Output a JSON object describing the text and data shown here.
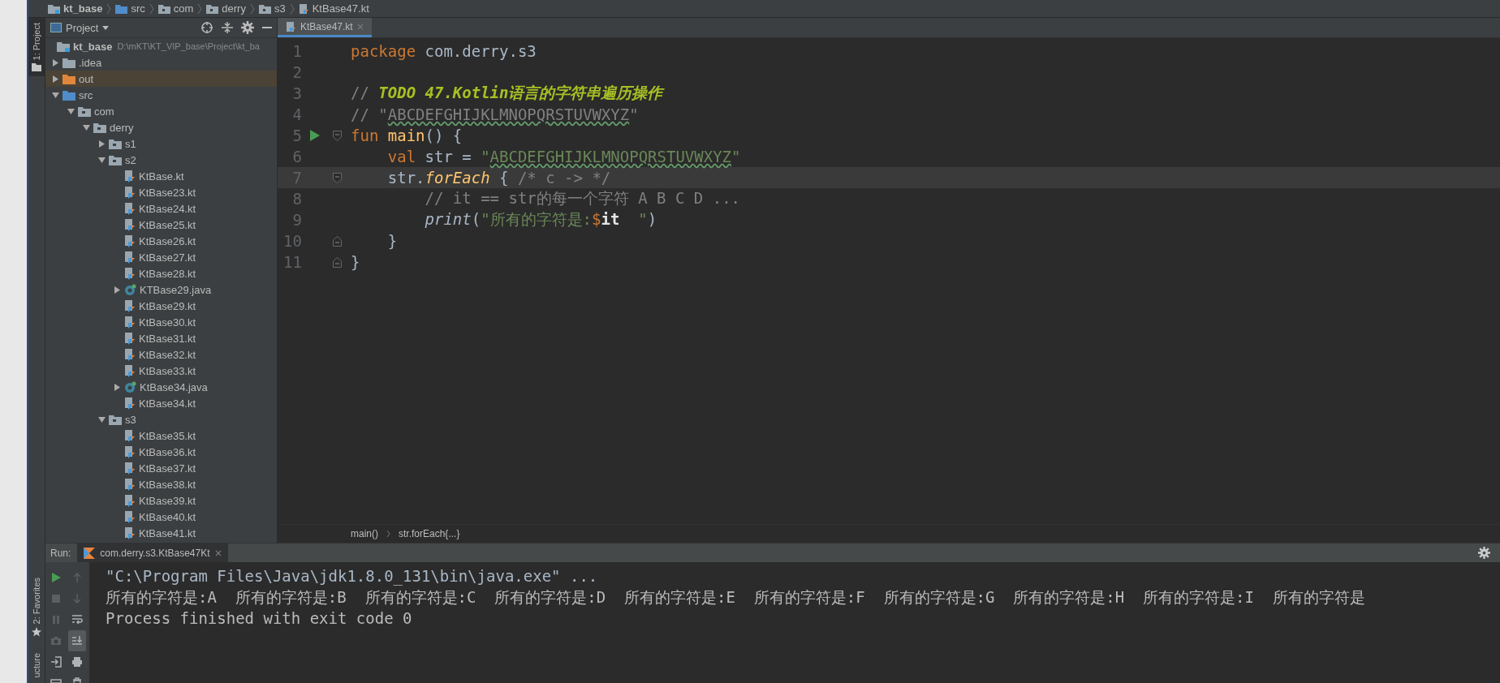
{
  "breadcrumbs": [
    {
      "label": "kt_base",
      "kind": "module"
    },
    {
      "label": "src",
      "kind": "source-folder"
    },
    {
      "label": "com",
      "kind": "package"
    },
    {
      "label": "derry",
      "kind": "package"
    },
    {
      "label": "s3",
      "kind": "package"
    },
    {
      "label": "KtBase47.kt",
      "kind": "kotlin-file"
    }
  ],
  "tool_strip": {
    "top": [
      {
        "label": "1: Project",
        "selected": true
      }
    ],
    "bottom": [
      {
        "label": "2: Favorites",
        "selected": false
      },
      {
        "label": "ucture",
        "selected": false
      }
    ]
  },
  "project": {
    "title": "Project",
    "tree": [
      {
        "label": "kt_base",
        "path": "D:\\mKT\\KT_VIP_base\\Project\\kt_ba",
        "kind": "module",
        "selected": false,
        "children": [
          {
            "label": ".idea",
            "kind": "folder",
            "expanded": false,
            "selected": false
          },
          {
            "label": "out",
            "kind": "excluded-folder",
            "expanded": false,
            "selected": true
          },
          {
            "label": "src",
            "kind": "source-folder",
            "expanded": true,
            "selected": false,
            "children": [
              {
                "label": "com",
                "kind": "package",
                "expanded": true,
                "selected": false,
                "children": [
                  {
                    "label": "derry",
                    "kind": "package",
                    "expanded": true,
                    "selected": false,
                    "children": [
                      {
                        "label": "s1",
                        "kind": "package",
                        "expanded": false,
                        "selected": false
                      },
                      {
                        "label": "s2",
                        "kind": "package",
                        "expanded": true,
                        "selected": false,
                        "children": [
                          {
                            "label": "KtBase.kt",
                            "kind": "kotlin-file",
                            "selected": false
                          },
                          {
                            "label": "KtBase23.kt",
                            "kind": "kotlin-file",
                            "selected": false
                          },
                          {
                            "label": "KtBase24.kt",
                            "kind": "kotlin-file",
                            "selected": false
                          },
                          {
                            "label": "KtBase25.kt",
                            "kind": "kotlin-file",
                            "selected": false
                          },
                          {
                            "label": "KtBase26.kt",
                            "kind": "kotlin-file",
                            "selected": false
                          },
                          {
                            "label": "KtBase27.kt",
                            "kind": "kotlin-file",
                            "selected": false
                          },
                          {
                            "label": "KtBase28.kt",
                            "kind": "kotlin-file",
                            "selected": false
                          },
                          {
                            "label": "KTBase29.java",
                            "kind": "java-class",
                            "expanded": false,
                            "selected": false
                          },
                          {
                            "label": "KtBase29.kt",
                            "kind": "kotlin-file",
                            "selected": false
                          },
                          {
                            "label": "KtBase30.kt",
                            "kind": "kotlin-file",
                            "selected": false
                          },
                          {
                            "label": "KtBase31.kt",
                            "kind": "kotlin-file",
                            "selected": false
                          },
                          {
                            "label": "KtBase32.kt",
                            "kind": "kotlin-file",
                            "selected": false
                          },
                          {
                            "label": "KtBase33.kt",
                            "kind": "kotlin-file",
                            "selected": false
                          },
                          {
                            "label": "KtBase34.java",
                            "kind": "java-class",
                            "expanded": false,
                            "selected": false
                          },
                          {
                            "label": "KtBase34.kt",
                            "kind": "kotlin-file",
                            "selected": false
                          }
                        ]
                      },
                      {
                        "label": "s3",
                        "kind": "package",
                        "expanded": true,
                        "selected": false,
                        "children": [
                          {
                            "label": "KtBase35.kt",
                            "kind": "kotlin-file",
                            "selected": false
                          },
                          {
                            "label": "KtBase36.kt",
                            "kind": "kotlin-file",
                            "selected": false
                          },
                          {
                            "label": "KtBase37.kt",
                            "kind": "kotlin-file",
                            "selected": false
                          },
                          {
                            "label": "KtBase38.kt",
                            "kind": "kotlin-file",
                            "selected": false
                          },
                          {
                            "label": "KtBase39.kt",
                            "kind": "kotlin-file",
                            "selected": false
                          },
                          {
                            "label": "KtBase40.kt",
                            "kind": "kotlin-file",
                            "selected": false
                          },
                          {
                            "label": "KtBase41.kt",
                            "kind": "kotlin-file",
                            "selected": false
                          }
                        ]
                      }
                    ]
                  }
                ]
              }
            ]
          }
        ]
      }
    ]
  },
  "editor": {
    "tabs": [
      {
        "label": "KtBase47.kt",
        "selected": true
      }
    ],
    "lines": [
      {
        "number": "1",
        "current": false,
        "tokens": [
          {
            "text": "package",
            "kind": "keyword"
          },
          {
            "text": " com.derry.s3",
            "kind": "plain"
          }
        ]
      },
      {
        "number": "2",
        "current": false
      },
      {
        "number": "3",
        "current": false,
        "tokens": [
          {
            "text": "// ",
            "kind": "comment"
          },
          {
            "text": "TODO 47.Kotlin语言的字符串遍历操作",
            "kind": "todo"
          }
        ]
      },
      {
        "number": "4",
        "current": false,
        "tokens": [
          {
            "text": "// \"",
            "kind": "comment"
          },
          {
            "text": "ABCDEFGHIJKLMNOPQRSTUVWXYZ",
            "kind": "comment-typo"
          },
          {
            "text": "\"",
            "kind": "comment"
          }
        ]
      },
      {
        "number": "5",
        "current": false,
        "run": true,
        "fold_open": true,
        "tokens": [
          {
            "text": "fun ",
            "kind": "keyword"
          },
          {
            "text": "main",
            "kind": "declaration"
          },
          {
            "text": "() {",
            "kind": "plain"
          }
        ]
      },
      {
        "number": "6",
        "current": false,
        "tokens": [
          {
            "text": "    val",
            "kind": "keyword"
          },
          {
            "text": " str = ",
            "kind": "plain"
          },
          {
            "text": "\"",
            "kind": "string"
          },
          {
            "text": "ABCDEFGHIJKLMNOPQRSTUVWXYZ",
            "kind": "string-typo"
          },
          {
            "text": "\"",
            "kind": "string"
          }
        ]
      },
      {
        "number": "7",
        "current": true,
        "fold_open": true,
        "tokens": [
          {
            "text": "    str.",
            "kind": "plain"
          },
          {
            "text": "forEach",
            "kind": "inline-call"
          },
          {
            "text": " { ",
            "kind": "plain"
          },
          {
            "text": "/* c -> */",
            "kind": "hint"
          }
        ]
      },
      {
        "number": "8",
        "current": false,
        "tokens": [
          {
            "text": "        // it == str的每一个字符 A B C D ...",
            "kind": "comment"
          }
        ]
      },
      {
        "number": "9",
        "current": false,
        "tokens": [
          {
            "text": "        print",
            "kind": "call"
          },
          {
            "text": "(",
            "kind": "plain"
          },
          {
            "text": "\"所有的字符是:",
            "kind": "string"
          },
          {
            "text": "$",
            "kind": "keyword"
          },
          {
            "text": "it",
            "kind": "template"
          },
          {
            "text": "  \"",
            "kind": "string"
          },
          {
            "text": ")",
            "kind": "plain"
          }
        ]
      },
      {
        "number": "10",
        "current": false,
        "fold_close": true,
        "tokens": [
          {
            "text": "    }",
            "kind": "plain"
          }
        ]
      },
      {
        "number": "11",
        "current": false,
        "fold_close": true,
        "tokens": [
          {
            "text": "}",
            "kind": "plain"
          }
        ]
      }
    ],
    "breadcrumbs": [
      "main()",
      "str.forEach{...}"
    ]
  },
  "run": {
    "label": "Run:",
    "tabs": [
      {
        "label": "com.derry.s3.KtBase47Kt",
        "selected": true
      }
    ],
    "toolbar": [
      {
        "kind": "rerun",
        "disabled": false,
        "toggled": false
      },
      {
        "kind": "up",
        "disabled": true,
        "toggled": false
      },
      {
        "kind": "stop",
        "disabled": true,
        "toggled": false
      },
      {
        "kind": "down",
        "disabled": true,
        "toggled": false
      },
      {
        "kind": "pause",
        "disabled": true,
        "toggled": false
      },
      {
        "kind": "wrap",
        "disabled": false,
        "toggled": false
      },
      {
        "kind": "camera",
        "disabled": true,
        "toggled": false
      },
      {
        "kind": "scroll-end",
        "disabled": false,
        "toggled": true
      },
      {
        "kind": "login",
        "disabled": false,
        "toggled": false
      },
      {
        "kind": "print",
        "disabled": false,
        "toggled": false
      },
      {
        "kind": "layout",
        "disabled": false,
        "toggled": false
      },
      {
        "kind": "trash",
        "disabled": false,
        "toggled": false
      }
    ],
    "output": [
      {
        "kind": "command",
        "text": "\"C:\\Program Files\\Java\\jdk1.8.0_131\\bin\\java.exe\" ..."
      },
      {
        "kind": "stdout",
        "text": "所有的字符是:A  所有的字符是:B  所有的字符是:C  所有的字符是:D  所有的字符是:E  所有的字符是:F  所有的字符是:G  所有的字符是:H  所有的字符是:I  所有的字符是"
      },
      {
        "kind": "status",
        "text": "Process finished with exit code 0"
      }
    ]
  }
}
